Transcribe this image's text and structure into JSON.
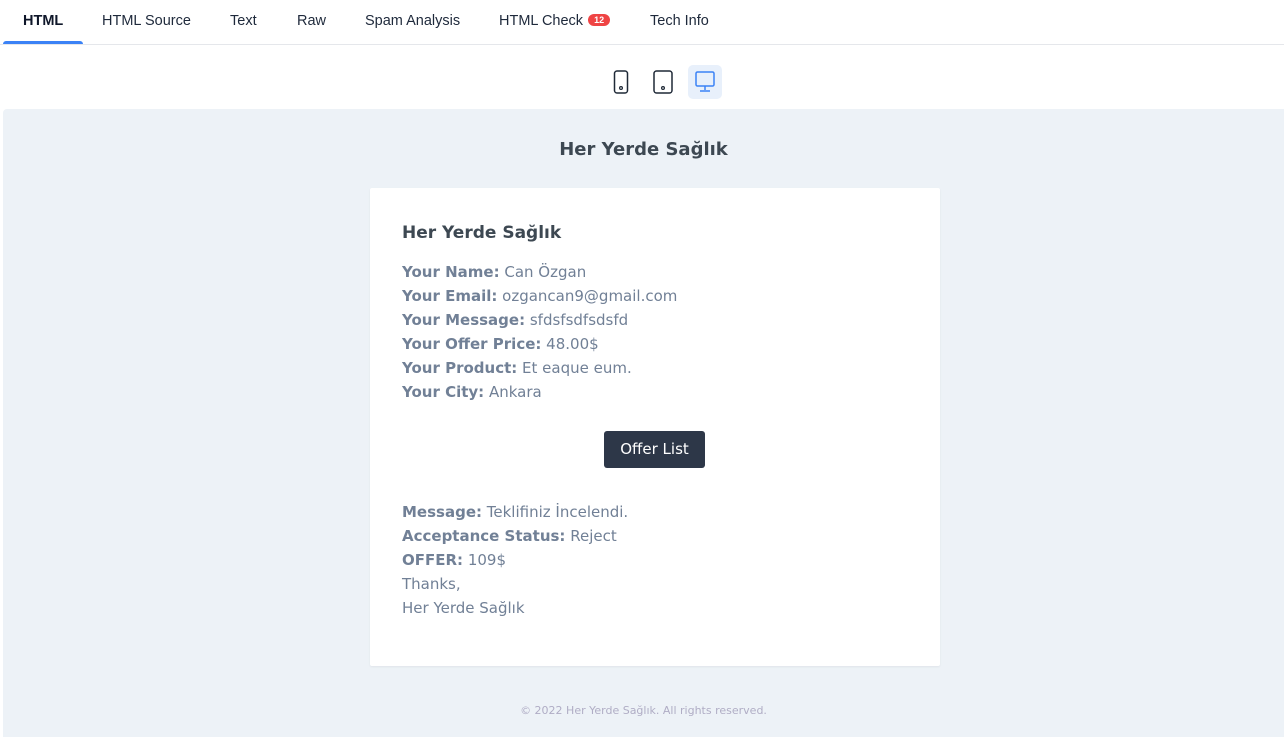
{
  "tabs": [
    {
      "label": "HTML",
      "active": true
    },
    {
      "label": "HTML Source"
    },
    {
      "label": "Text"
    },
    {
      "label": "Raw"
    },
    {
      "label": "Spam Analysis"
    },
    {
      "label": "HTML Check",
      "badge": "12"
    },
    {
      "label": "Tech Info"
    }
  ],
  "devices": [
    {
      "icon": "mobile-icon"
    },
    {
      "icon": "tablet-icon"
    },
    {
      "icon": "desktop-icon",
      "active": true
    }
  ],
  "colors": {
    "accent": "#3b82f6",
    "badge": "#ef4444",
    "button": "#2d3748",
    "preview_bg": "#edf2f7"
  },
  "email": {
    "header_title": "Her Yerde Sağlık",
    "card_title": "Her Yerde Sağlık",
    "fields": [
      {
        "label": "Your Name:",
        "value": "Can Özgan"
      },
      {
        "label": "Your Email:",
        "value": "ozgancan9@gmail.com"
      },
      {
        "label": "Your Message:",
        "value": "sfdsfsdfsdsfd"
      },
      {
        "label": "Your Offer Price:",
        "value": "48.00$"
      },
      {
        "label": "Your Product:",
        "value": "Et eaque eum."
      },
      {
        "label": "Your City:",
        "value": "Ankara"
      }
    ],
    "button_label": "Offer List",
    "reply": [
      {
        "label": "Message:",
        "value": "Teklifiniz İncelendi."
      },
      {
        "label": "Acceptance Status:",
        "value": "Reject"
      },
      {
        "label": "OFFER:",
        "value": "109$"
      }
    ],
    "closing": "Thanks,",
    "signature": "Her Yerde Sağlık",
    "footer": "© 2022 Her Yerde Sağlık. All rights reserved."
  }
}
